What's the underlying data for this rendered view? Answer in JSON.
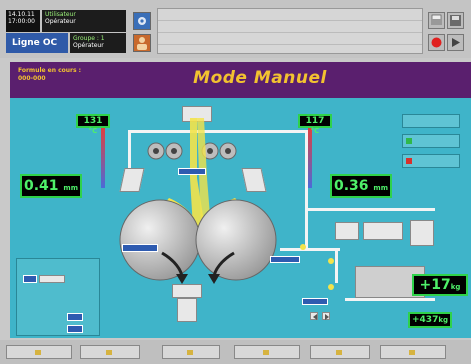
{
  "header": {
    "date": "14.10.11",
    "time": "17:00:00",
    "operator_role_1": "Utilisateur",
    "operator_name_1": "Opérateur",
    "line_label": "Ligne OC",
    "operator_role_2": "Groupe : 1",
    "operator_name_2": "Opérateur",
    "formula_label": "Formule en cours :",
    "formula_value": "000-000",
    "title": "Mode Manuel"
  },
  "process": {
    "left_temp_value": "131",
    "left_temp_unit": "°C",
    "right_temp_value": "117",
    "right_temp_unit": "°C",
    "left_gap_value": "0.41",
    "left_gap_unit": "mm",
    "right_gap_value": "0.36",
    "right_gap_unit": "mm",
    "weight_value": "+17",
    "weight_unit": "kg",
    "flow_value": "+437",
    "flow_unit": "kg"
  },
  "colors": {
    "process_bg": "#3fb4c9",
    "header_bg": "#5a1f6e",
    "title_color": "#f2c230",
    "value_green": "#4ff06a"
  },
  "icons": [
    "gear-icon",
    "user-icon",
    "print-icon",
    "stop-icon",
    "save-icon",
    "play-icon"
  ]
}
